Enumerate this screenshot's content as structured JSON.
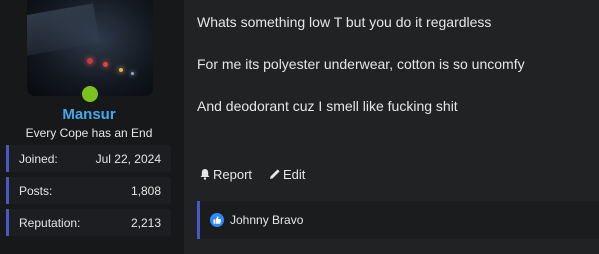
{
  "user": {
    "name": "Mansur",
    "title": "Every Cope has an End",
    "stats": [
      {
        "label": "Joined:",
        "value": "Jul 22, 2024"
      },
      {
        "label": "Posts:",
        "value": "1,808"
      },
      {
        "label": "Reputation:",
        "value": "2,213"
      }
    ],
    "online_color": "#7bc21d"
  },
  "post": {
    "paragraphs": [
      "Whats something low T but you do it regardless",
      "For me its polyester underwear, cotton is so uncomfy",
      "And deodorant cuz I smell like fucking shit"
    ],
    "actions": {
      "report": "Report",
      "edit": "Edit"
    },
    "reactions": {
      "icon": "like-icon",
      "names": "Johnny Bravo"
    }
  },
  "colors": {
    "username": "#47a7eb",
    "accent_border": "#4a57c5",
    "like": "#2e89ff"
  }
}
